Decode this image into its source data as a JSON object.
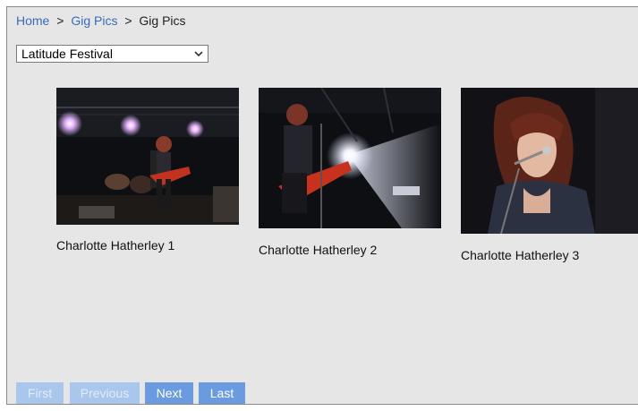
{
  "breadcrumb": {
    "home": "Home",
    "separator": ">",
    "section": "Gig Pics",
    "current": "Gig Pics"
  },
  "gallery_select": {
    "selected": "Latitude Festival"
  },
  "photos": [
    {
      "caption": "Charlotte Hatherley 1"
    },
    {
      "caption": "Charlotte Hatherley 2"
    },
    {
      "caption": "Charlotte Hatherley 3"
    }
  ],
  "pagination": {
    "first": "First",
    "previous": "Previous",
    "next": "Next",
    "last": "Last"
  },
  "colors": {
    "panel_bg": "#e6e6e6",
    "link": "#3a6bbd",
    "pager_active": "#6a9be0",
    "pager_disabled": "#a9c6ec"
  }
}
